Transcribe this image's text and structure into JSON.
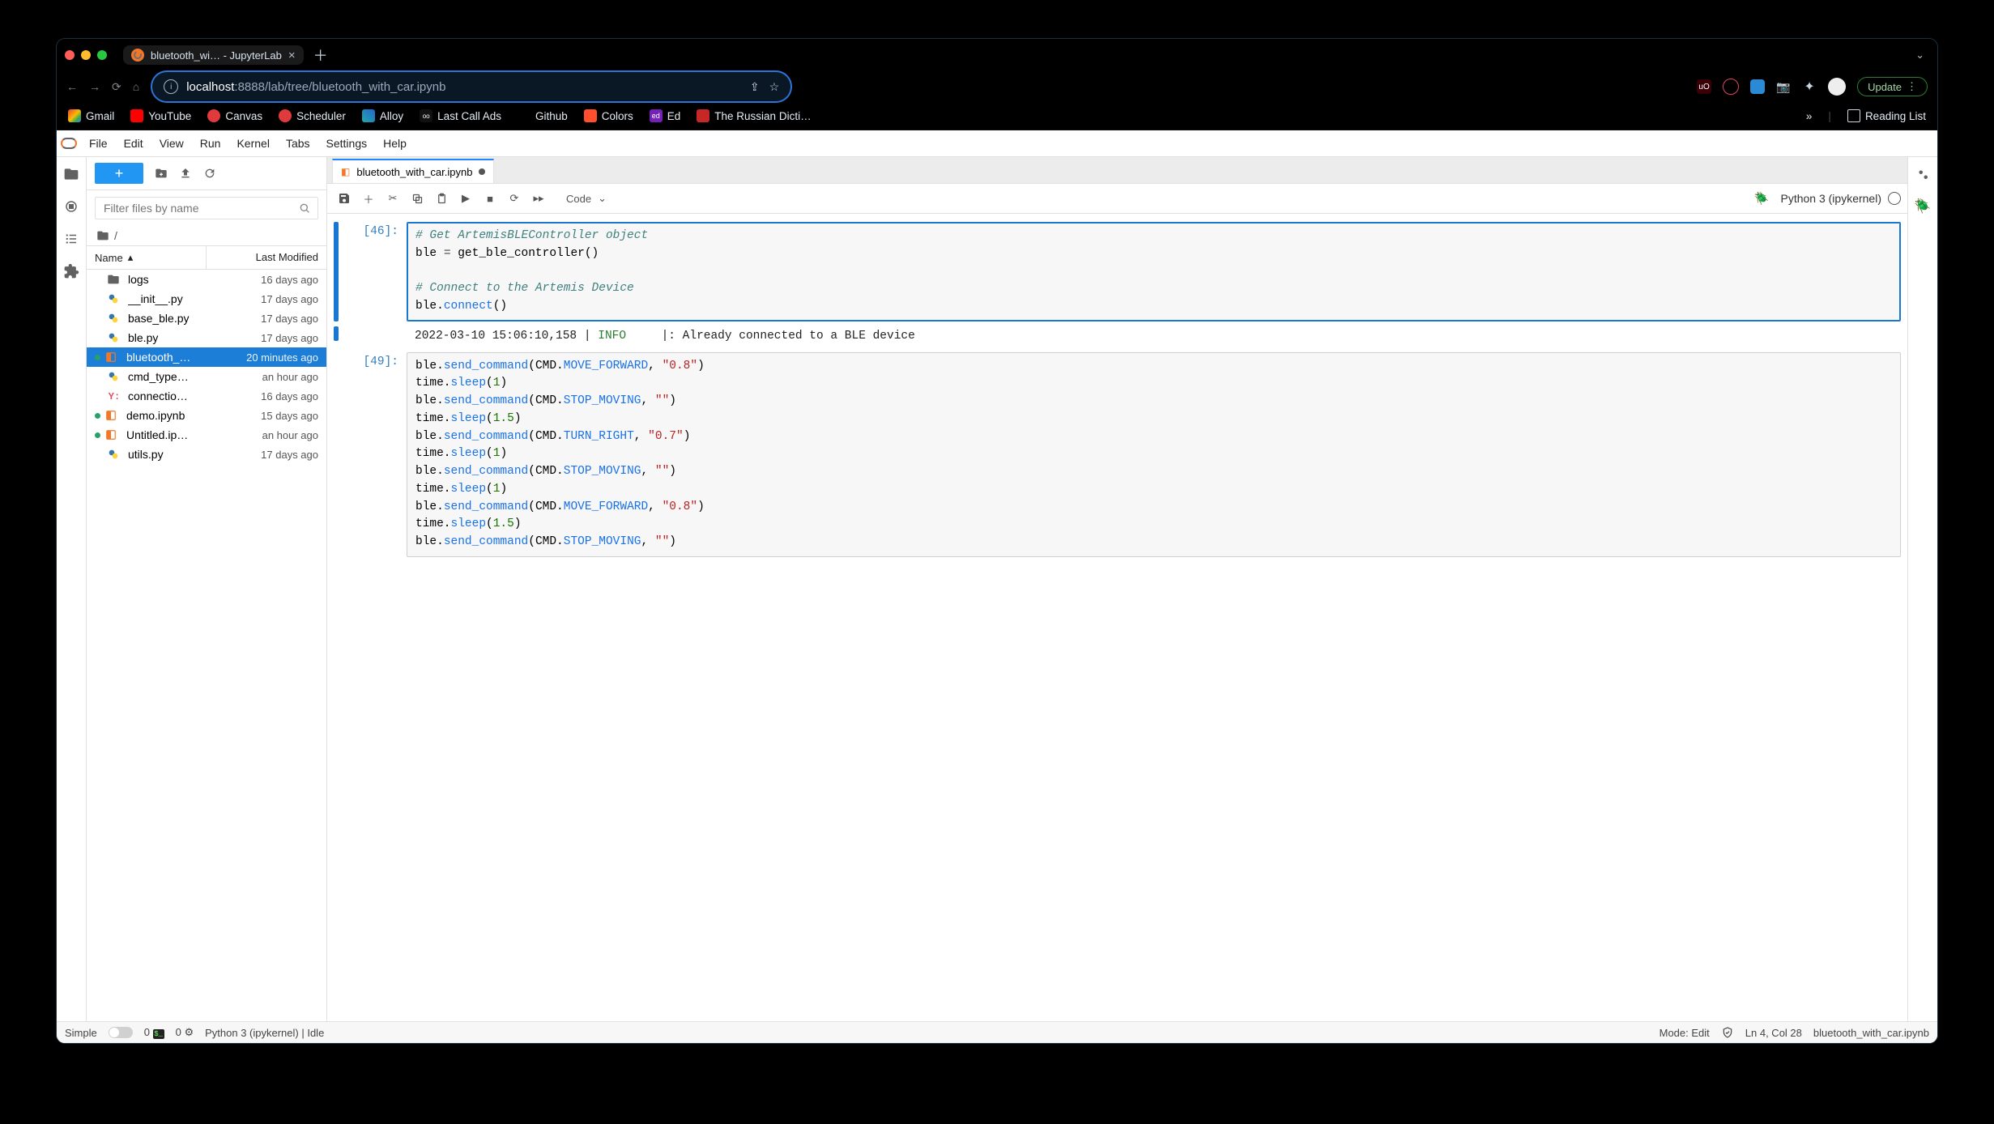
{
  "browser": {
    "tab_title": "bluetooth_wi… - JupyterLab",
    "url_host": "localhost",
    "url_rest": ":8888/lab/tree/bluetooth_with_car.ipynb",
    "update_label": "Update",
    "reading_list_label": "Reading List",
    "overflow_glyph": "»",
    "bookmarks": [
      {
        "id": "gmail",
        "label": "Gmail",
        "icon": "gm"
      },
      {
        "id": "youtube",
        "label": "YouTube",
        "icon": "yt"
      },
      {
        "id": "canvas",
        "label": "Canvas",
        "icon": "cv"
      },
      {
        "id": "scheduler",
        "label": "Scheduler",
        "icon": "sc"
      },
      {
        "id": "alloy",
        "label": "Alloy",
        "icon": "al"
      },
      {
        "id": "lastcall",
        "label": "Last Call Ads",
        "icon": "lc"
      },
      {
        "id": "github",
        "label": "Github",
        "icon": "gh"
      },
      {
        "id": "colors",
        "label": "Colors",
        "icon": "co"
      },
      {
        "id": "ed",
        "label": "Ed",
        "icon": "ed"
      },
      {
        "id": "russian",
        "label": "The Russian Dicti…",
        "icon": "rd"
      }
    ]
  },
  "menubar": [
    "File",
    "Edit",
    "View",
    "Run",
    "Kernel",
    "Tabs",
    "Settings",
    "Help"
  ],
  "sidebar": {
    "filter_placeholder": "Filter files by name",
    "crumb_root": "/",
    "col_name": "Name",
    "col_mod": "Last Modified",
    "files": [
      {
        "icon": "folder",
        "name": "logs",
        "mod": "16 days ago",
        "running": false,
        "sel": false
      },
      {
        "icon": "py",
        "name": "__init__.py",
        "mod": "17 days ago",
        "running": false,
        "sel": false
      },
      {
        "icon": "py",
        "name": "base_ble.py",
        "mod": "17 days ago",
        "running": false,
        "sel": false
      },
      {
        "icon": "py",
        "name": "ble.py",
        "mod": "17 days ago",
        "running": false,
        "sel": false
      },
      {
        "icon": "nb",
        "name": "bluetooth_…",
        "mod": "20 minutes ago",
        "running": true,
        "sel": true
      },
      {
        "icon": "py",
        "name": "cmd_type…",
        "mod": "an hour ago",
        "running": false,
        "sel": false
      },
      {
        "icon": "yml",
        "name": "connectio…",
        "mod": "16 days ago",
        "running": false,
        "sel": false
      },
      {
        "icon": "nb",
        "name": "demo.ipynb",
        "mod": "15 days ago",
        "running": true,
        "sel": false
      },
      {
        "icon": "nb",
        "name": "Untitled.ip…",
        "mod": "an hour ago",
        "running": true,
        "sel": false
      },
      {
        "icon": "py",
        "name": "utils.py",
        "mod": "17 days ago",
        "running": false,
        "sel": false
      }
    ]
  },
  "tab": {
    "filename": "bluetooth_with_car.ipynb"
  },
  "toolbar": {
    "cell_type": "Code",
    "kernel_name": "Python 3 (ipykernel)"
  },
  "cells": {
    "p46": "[46]:",
    "c46_l1": "# Get ArtemisBLEController object",
    "c46_l2a": "ble ",
    "c46_l2b": "=",
    "c46_l2c": " get_ble_controller()",
    "c46_l4": "# Connect to the Artemis Device",
    "c46_l5a": "ble.",
    "c46_l5b": "connect",
    "c46_l5c": "()",
    "out46_ts": "2022-03-10 15:06:10,158 ",
    "out46_bar": "|",
    "out46_lvl": " INFO     ",
    "out46_msg": "|: Already connected to a BLE device",
    "p49": "[49]:",
    "c49": {
      "ble": "ble.",
      "send": "send_command",
      "lp": "(",
      "cmd": "CMD.",
      "rp": ")",
      "mv": "MOVE_FORWARD",
      "stop": "STOP_MOVING",
      "tr": "TURN_RIGHT",
      "comma": ", ",
      "s08": "\"0.8\"",
      "sempty": "\"\"",
      "s07": "\"0.7\"",
      "time": "time.",
      "sleep": "sleep",
      "n1": "1",
      "n15": "1.5"
    }
  },
  "status": {
    "simple": "Simple",
    "zero1": "0",
    "zero2": "0",
    "kernel": "Python 3 (ipykernel) | Idle",
    "mode": "Mode: Edit",
    "pos": "Ln 4, Col 28",
    "file": "bluetooth_with_car.ipynb"
  }
}
